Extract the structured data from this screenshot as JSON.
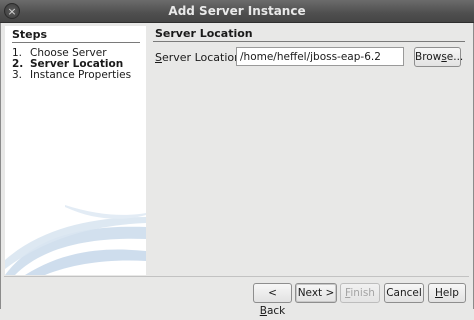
{
  "window": {
    "title": "Add Server Instance",
    "close_glyph": "×"
  },
  "steps": {
    "title": "Steps",
    "items": [
      {
        "num": "1.",
        "label": "Choose Server"
      },
      {
        "num": "2.",
        "label": "Server Location"
      },
      {
        "num": "3.",
        "label": "Instance Properties"
      }
    ],
    "current_index": 1
  },
  "panel": {
    "header": "Server Location",
    "field_label_mnemonic": "S",
    "field_label_rest": "erver Location:",
    "field_value": "/home/heffel/jboss-eap-6.2",
    "browse_label_pre": "Brow",
    "browse_mnemonic": "s",
    "browse_label_post": "e..."
  },
  "buttons": {
    "back_pre": "< ",
    "back_mnemonic": "B",
    "back_post": "ack",
    "next_pre": "Next ",
    "next_post": ">",
    "finish_mnemonic": "F",
    "finish_post": "inish",
    "cancel": "Cancel",
    "help_mnemonic": "H",
    "help_post": "elp"
  },
  "colors": {
    "titlebar": "#4f4f4f",
    "swoosh": "#b9cfe6"
  }
}
